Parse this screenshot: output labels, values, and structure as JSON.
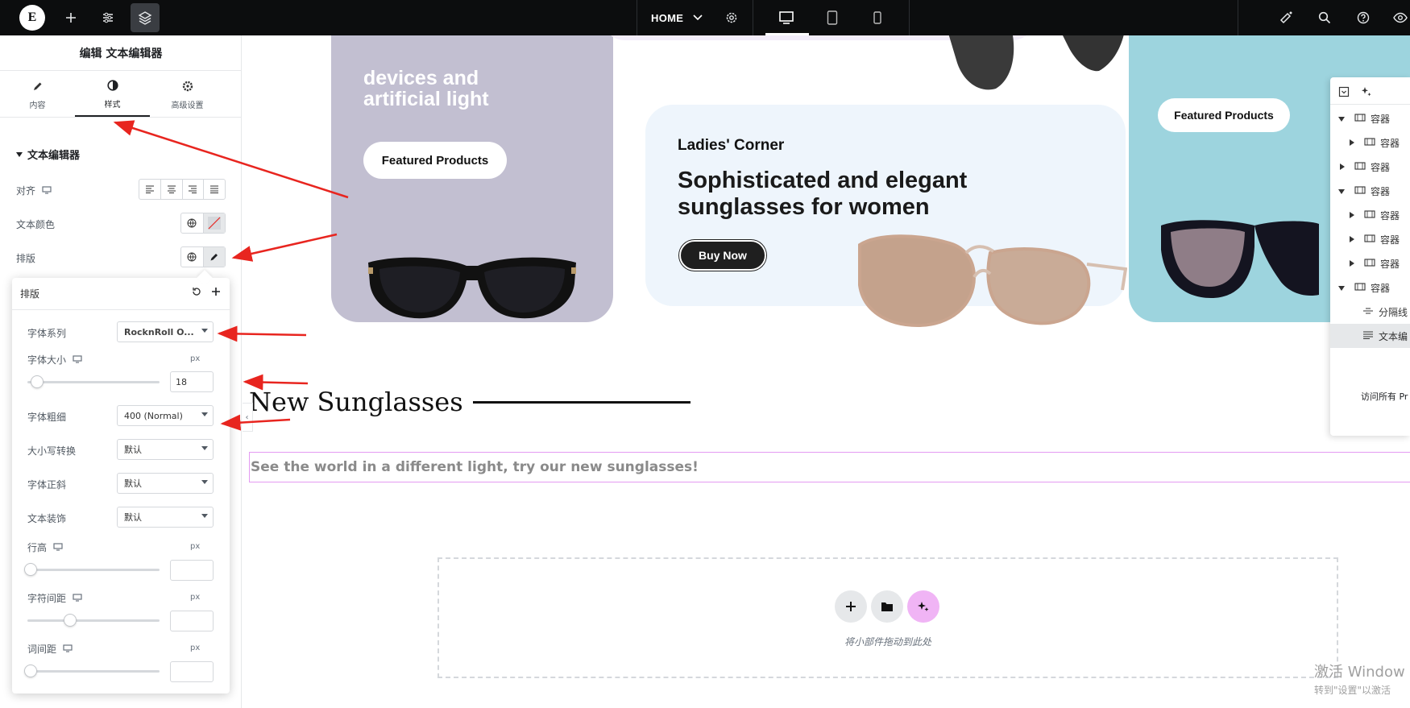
{
  "topbar": {
    "page_name": "HOME",
    "logo_text": "E"
  },
  "panel": {
    "title": "编辑 文本编辑器",
    "tabs": [
      {
        "label": "内容"
      },
      {
        "label": "样式"
      },
      {
        "label": "高级设置"
      }
    ],
    "section_title": "文本编辑器",
    "align_label": "对齐",
    "color_label": "文本颜色",
    "typography_label": "排版"
  },
  "popover": {
    "title": "排版",
    "font_family_label": "字体系列",
    "font_family_value": "RocknRoll O...",
    "font_size_label": "字体大小",
    "font_size_unit": "px",
    "font_size_value": "18",
    "font_weight_label": "字体粗细",
    "font_weight_value": "400 (Normal)",
    "transform_label": "大小写转换",
    "transform_value": "默认",
    "style_label": "字体正斜",
    "style_value": "默认",
    "decoration_label": "文本装饰",
    "decoration_value": "默认",
    "line_height_label": "行高",
    "line_height_unit": "px",
    "letter_spacing_label": "字符间距",
    "letter_spacing_unit": "px",
    "word_spacing_label": "词间距",
    "word_spacing_unit": "px"
  },
  "canvas": {
    "card1_text_line1": "devices and",
    "card1_text_line2": "artificial light",
    "card1_button": "Featured Products",
    "card2_kicker": "Ladies' Corner",
    "card2_title_line1": "Sophisticated and elegant",
    "card2_title_line2": "sunglasses for women",
    "card2_button": "Buy Now",
    "card3_button": "Featured Products",
    "section_heading": "New Sunglasses",
    "section_text": "See the world in a different light, try our new sunglasses!",
    "drop_hint": "将小部件拖动到此处",
    "windows_line1": "激活 Window",
    "windows_line2": "转到\"设置\"以激活"
  },
  "navigator": {
    "items": [
      {
        "label": "容器"
      },
      {
        "label": "容器"
      },
      {
        "label": "容器"
      },
      {
        "label": "容器"
      },
      {
        "label": "容器"
      },
      {
        "label": "容器"
      },
      {
        "label": "容器"
      },
      {
        "label": "容器"
      },
      {
        "label": "分隔线"
      },
      {
        "label": "文本编"
      }
    ],
    "footer": "访问所有 Pr"
  },
  "colors": {
    "card1_bg": "#c2bfd1",
    "card2_bg": "#eef5fc",
    "card3_bg": "#9dd4de",
    "topbar_bg": "#0c0d0e",
    "arrow": "#e8251f",
    "ai_button": "#f0b4f5"
  }
}
